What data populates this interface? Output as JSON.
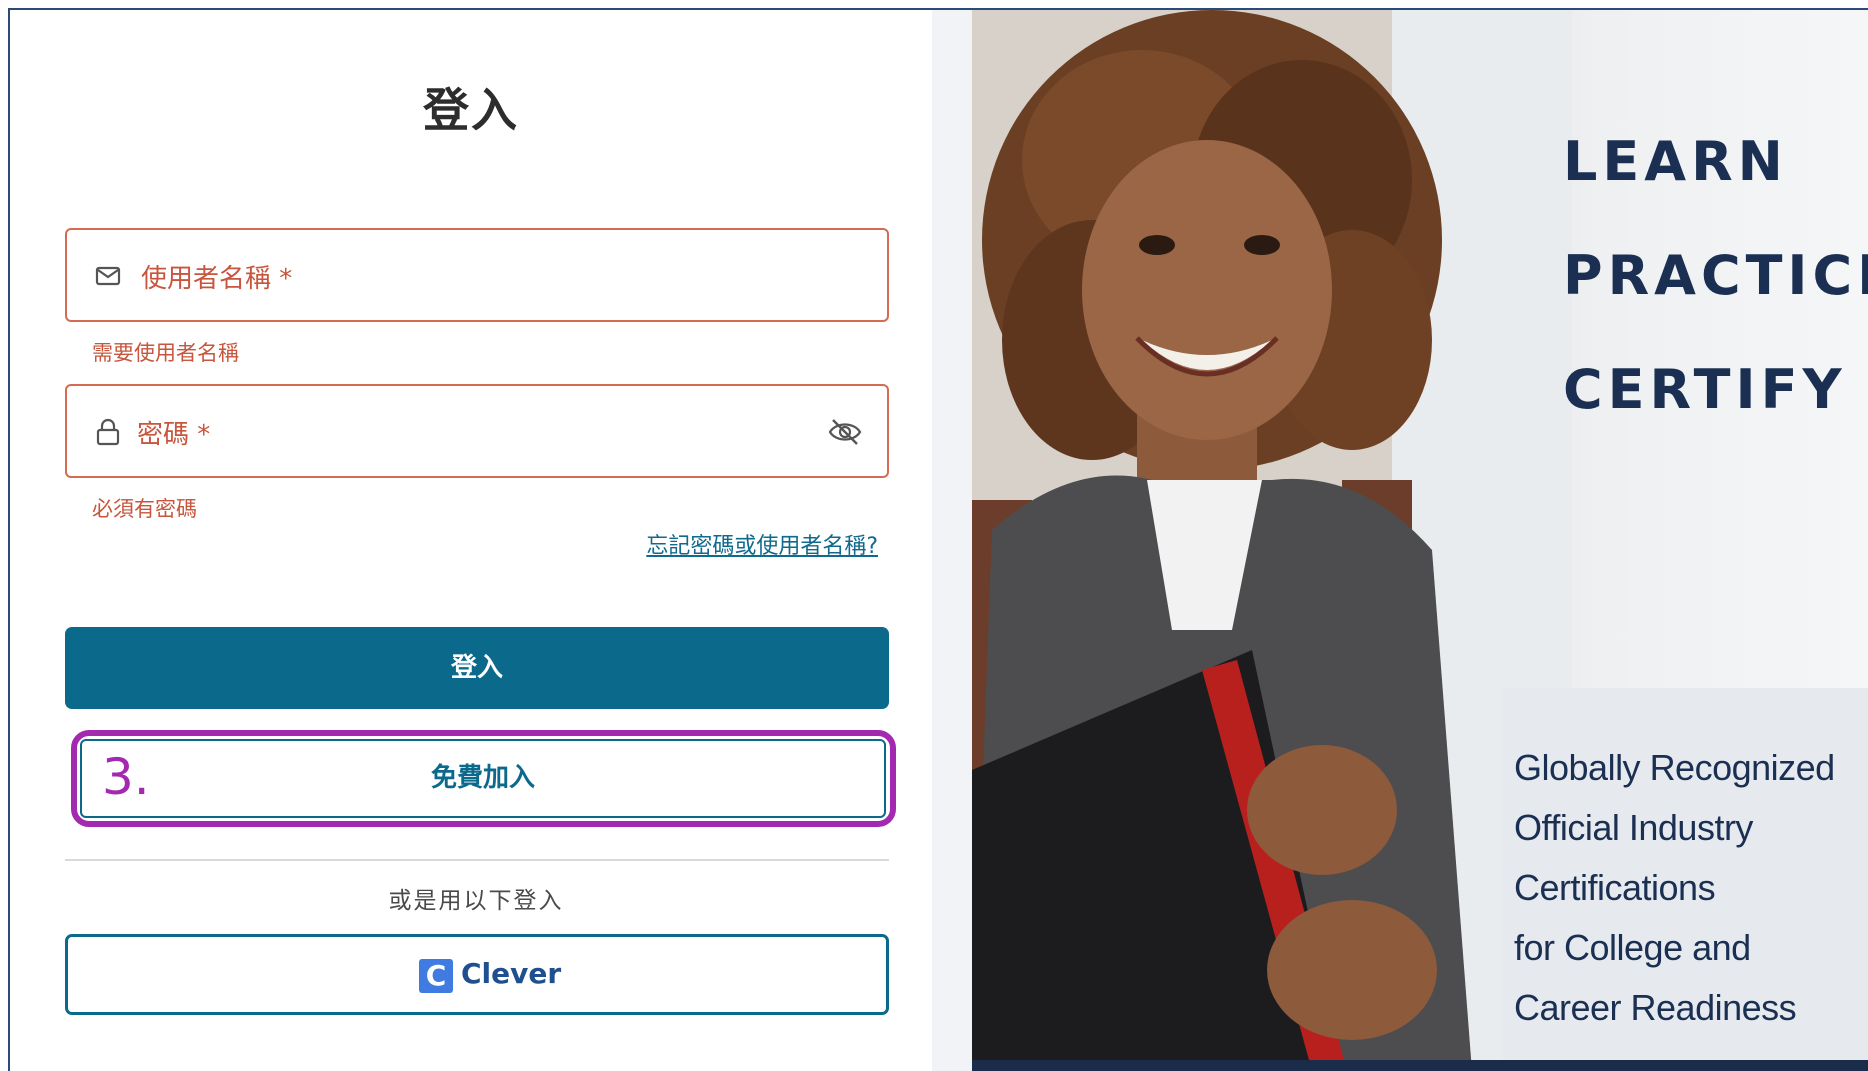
{
  "login_form": {
    "title": "登入",
    "username": {
      "label": "使用者名稱 *",
      "error": "需要使用者名稱"
    },
    "password": {
      "label": "密碼 *",
      "error": "必須有密碼"
    },
    "forgot_link": "忘記密碼或使用者名稱?",
    "login_button": "登入",
    "join_button": "免費加入",
    "or_text": "或是用以下登入",
    "clever_button": "Clever",
    "clever_logo_letter": "C"
  },
  "annotation": {
    "step_label": "3.",
    "color": "#a32ab0"
  },
  "promo": {
    "words": [
      "LEARN",
      "PRACTICE",
      "CERTIFY"
    ],
    "tagline_lines": [
      "Globally Recognized",
      "Official Industry",
      "Certifications",
      "for College and",
      "Career Readiness"
    ]
  },
  "colors": {
    "primary": "#0b6a8c",
    "error": "#c8553d",
    "promo_text": "#1a2f52"
  }
}
